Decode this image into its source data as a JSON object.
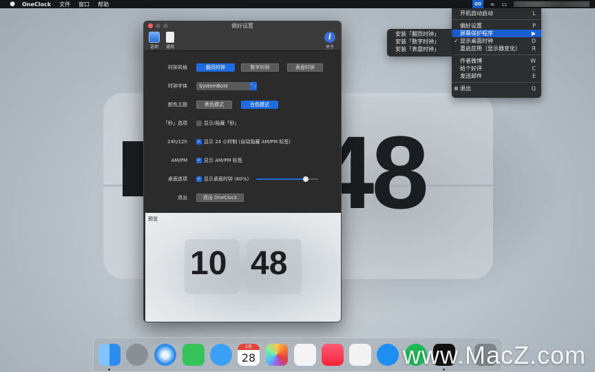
{
  "menubar": {
    "app_name": "OneClock",
    "items": [
      "文件",
      "窗口",
      "帮助"
    ],
    "status_app": "00"
  },
  "desktop": {
    "clock_digits": "48"
  },
  "status_menu": {
    "items": [
      {
        "label": "开机自动启动",
        "shortcut": "L"
      },
      {
        "label": "偏好设置",
        "shortcut": "P"
      },
      {
        "label": "屏幕保护程序",
        "shortcut": "▶",
        "highlighted": true
      },
      {
        "label": "显示桌面时钟",
        "shortcut": "D",
        "checked": true
      },
      {
        "label": "重启应用（显示器变化）",
        "shortcut": "R"
      },
      {
        "label": "作者微博",
        "shortcut": "W"
      },
      {
        "label": "给个好评",
        "shortcut": "C"
      },
      {
        "label": "发送邮件",
        "shortcut": "E"
      },
      {
        "label": "退出",
        "shortcut": "Q"
      }
    ],
    "checkmark": "✓",
    "quit_icon": "⊗"
  },
  "screensaver_submenu": {
    "items": [
      "安装「翻页时钟」",
      "安装「数字时钟」",
      "安装「表盘时钟」"
    ]
  },
  "prefs": {
    "title": "偏好设置",
    "toolbar": {
      "options": "选项",
      "general": "通用",
      "about": "关于",
      "about_glyph": "i"
    },
    "clock_style": {
      "label": "时钟风格",
      "options": [
        "翻页时钟",
        "数字时钟",
        "表盘时钟"
      ],
      "selected": "翻页时钟"
    },
    "clock_font": {
      "label": "时钟字体",
      "value": "SystemBold",
      "arrow": "⌃⌄"
    },
    "color_theme": {
      "label": "颜色主题",
      "options": [
        "黑色模式",
        "白色模式"
      ],
      "selected": "白色模式"
    },
    "seconds": {
      "label": "「秒」选项",
      "checkbox": "显示/隐藏「秒」",
      "checked": false
    },
    "hour_format": {
      "label": "24h/12h",
      "checkbox": "显示 24 小时制 (自动隐藏 AM/PM 标签)",
      "checked": true
    },
    "ampm": {
      "label": "AM/PM",
      "checkbox": "显示 AM/PM 标签",
      "checked": true
    },
    "desktop": {
      "label": "桌面选项",
      "checkbox": "显示桌面时钟 (80%)",
      "checked": true,
      "opacity_fraction": 0.8
    },
    "quit": {
      "label": "退出",
      "button": "退出 OneClock"
    },
    "preview": {
      "label": "预览",
      "hours": "10",
      "minutes": "48"
    },
    "checkmark": "✓"
  },
  "dock": {
    "calendar_month": "2月",
    "calendar_day": "28",
    "apps": [
      "finder-icon",
      "launchpad-icon",
      "safari-icon",
      "facetime-icon",
      "messages-icon",
      "calendar-icon",
      "photos-icon",
      "reminders-icon",
      "music-icon",
      "z-app-icon",
      "app-store-icon",
      "spotify-icon",
      "oneclock-icon",
      "trash-icon"
    ]
  },
  "watermark": "www.MacZ.com"
}
